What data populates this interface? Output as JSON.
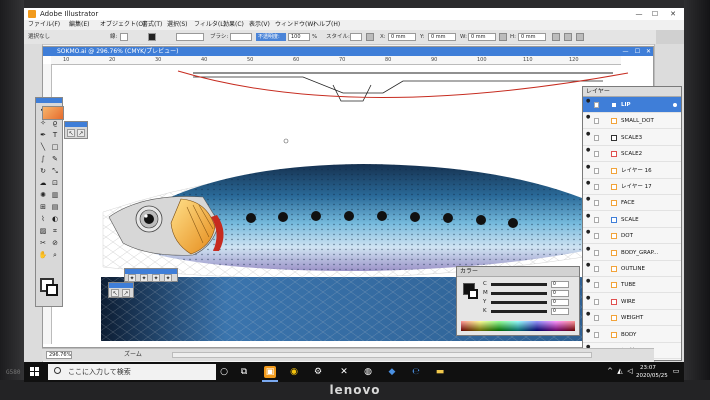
{
  "device": {
    "brand": "lenovo",
    "model": "G580"
  },
  "window": {
    "title": "Adobe Illustrator",
    "min": "—",
    "max": "☐",
    "close": "✕"
  },
  "menu": [
    "ファイル(F)",
    "編集(E)",
    "オブジェクト(O)",
    "書式(T)",
    "選択(S)",
    "フィルタ(L)",
    "効果(C)",
    "表示(V)",
    "ウィンドウ(W)",
    "ヘルプ(H)"
  ],
  "control_bar": {
    "selection_label": "選択なし",
    "stroke_label": "線:",
    "brush_label": "ブラシ:",
    "opacity_label": "不透明度:",
    "opacity_value": "100",
    "opacity_unit": "%",
    "style_label": "スタイル:",
    "x_label": "X:",
    "x_value": "0 mm",
    "y_label": "Y:",
    "y_value": "0 mm",
    "w_label": "W:",
    "w_value": "0 mm",
    "h_label": "H:",
    "h_value": "0 mm"
  },
  "document": {
    "tab_title": "SOKMO.ai @ 296.76% (CMYK/プレビュー)",
    "ruler_labels": [
      "10",
      "20",
      "30",
      "40",
      "50",
      "60",
      "70",
      "80",
      "90",
      "100",
      "110",
      "120"
    ]
  },
  "status": {
    "zoom": "296.76%",
    "text": "ズーム"
  },
  "layers_panel": {
    "title": "レイヤー",
    "layers": [
      {
        "name": "LIP",
        "selected": true,
        "color": "#3f7ed8"
      },
      {
        "name": "SMALL_DOT",
        "selected": false,
        "color": "#f2a33a"
      },
      {
        "name": "SCALE3",
        "selected": false,
        "color": "#333333"
      },
      {
        "name": "SCALE2",
        "selected": false,
        "color": "#e05050"
      },
      {
        "name": "レイヤー 16",
        "selected": false,
        "color": "#f2a33a"
      },
      {
        "name": "レイヤー 17",
        "selected": false,
        "color": "#f2a33a"
      },
      {
        "name": "FACE",
        "selected": false,
        "color": "#f2a33a"
      },
      {
        "name": "SCALE",
        "selected": false,
        "color": "#3f7ed8"
      },
      {
        "name": "DOT",
        "selected": false,
        "color": "#f2a33a"
      },
      {
        "name": "BODY_GRAP...",
        "selected": false,
        "color": "#f2a33a"
      },
      {
        "name": "OUTLINE",
        "selected": false,
        "color": "#f2a33a"
      },
      {
        "name": "TUBE",
        "selected": false,
        "color": "#f2a33a"
      },
      {
        "name": "WIRE",
        "selected": false,
        "color": "#e05050"
      },
      {
        "name": "WEIGHT",
        "selected": false,
        "color": "#f2a33a"
      },
      {
        "name": "BODY",
        "selected": false,
        "color": "#f2a33a"
      },
      {
        "name": "レイヤー 1",
        "selected": false,
        "color": "#f2a33a"
      }
    ]
  },
  "color_panel": {
    "title": "カラー",
    "channels": [
      "C",
      "M",
      "Y",
      "K"
    ],
    "values": [
      "0",
      "0",
      "0",
      "0"
    ]
  },
  "taskbar": {
    "search_placeholder": "ここに入力して検索",
    "time": "23:07",
    "date": "2020/05/25"
  },
  "colors": {
    "accent": "#3f7ed8",
    "fish_back": "#1e3f66",
    "fish_belly": "#e9e9f5",
    "lip_red": "#c62b1f"
  },
  "icons": {
    "start": "windows-start-icon",
    "search": "search-icon",
    "task_view": "task-view-icon"
  }
}
